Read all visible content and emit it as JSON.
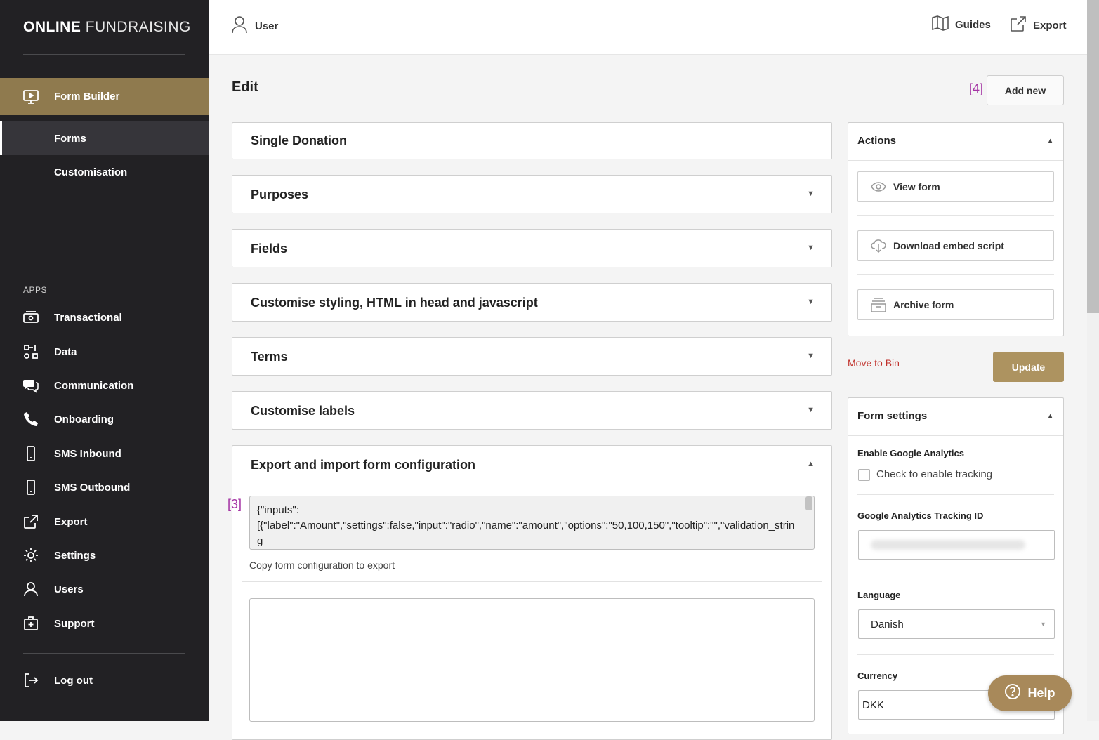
{
  "brand": {
    "bold": "ONLINE",
    "light": "FUNDRAISING"
  },
  "sidebar": {
    "form_builder": "Form Builder",
    "forms": "Forms",
    "customisation": "Customisation",
    "apps_label": "APPS",
    "apps": [
      {
        "label": "Transactional",
        "icon": "money-icon"
      },
      {
        "label": "Data",
        "icon": "data-icon"
      },
      {
        "label": "Communication",
        "icon": "chat-icon"
      },
      {
        "label": "Onboarding",
        "icon": "phone-icon"
      },
      {
        "label": "SMS Inbound",
        "icon": "mobile-icon"
      },
      {
        "label": "SMS Outbound",
        "icon": "mobile-icon"
      },
      {
        "label": "Export",
        "icon": "export-icon"
      },
      {
        "label": "Settings",
        "icon": "gear-icon"
      },
      {
        "label": "Users",
        "icon": "user-icon"
      },
      {
        "label": "Support",
        "icon": "support-icon"
      }
    ],
    "logout": "Log out"
  },
  "topbar": {
    "user": "User",
    "guides": "Guides",
    "export": "Export"
  },
  "main": {
    "title": "Edit",
    "marker_add": "[4]",
    "add_new": "Add new",
    "panels": [
      "Single Donation",
      "Purposes",
      "Fields",
      "Customise styling, HTML in head and javascript",
      "Terms",
      "Customise labels",
      "Export and import form configuration"
    ],
    "marker_config": "[3]",
    "config_text": "{\"inputs\":\n[{\"label\":\"Amount\",\"settings\":false,\"input\":\"radio\",\"name\":\"amount\",\"options\":\"50,100,150\",\"tooltip\":\"\",\"validation_string\n\":\"\",\"label_id\":\"amount\"},{\"label\":\"Payment",
    "copy_hint": "Copy form configuration to export",
    "import_value": ""
  },
  "actions": {
    "title": "Actions",
    "view_form": "View form",
    "download_embed": "Download embed script",
    "archive_form": "Archive form",
    "move_to_bin": "Move to Bin",
    "update": "Update"
  },
  "settings": {
    "title": "Form settings",
    "ga_label": "Enable Google Analytics",
    "ga_checkbox": "Check to enable tracking",
    "ga_checked": false,
    "tracking_label": "Google Analytics Tracking ID",
    "language_label": "Language",
    "language_value": "Danish",
    "currency_label": "Currency",
    "currency_value": "DKK"
  },
  "help": "Help",
  "colors": {
    "sidebar_bg": "#222124",
    "accent": "#8f7a4e",
    "update_btn": "#ad9360",
    "danger": "#c0312b",
    "marker": "#a433a4"
  }
}
